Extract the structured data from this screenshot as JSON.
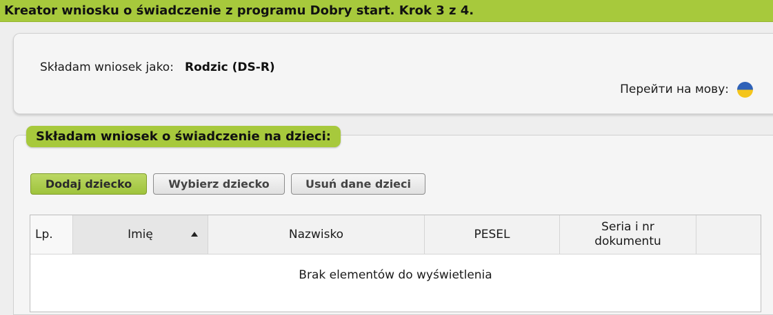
{
  "header": {
    "title": "Kreator wniosku o świadczenie z programu Dobry start. Krok 3 z 4."
  },
  "applicant": {
    "label": "Składam wniosek jako:",
    "value": "Rodzic (DS-R)"
  },
  "language_switch": {
    "label": "Перейти на мову:",
    "flag_icon": "ukraine-flag-icon"
  },
  "children_section": {
    "title": "Składam wniosek o świadczenie na dzieci:",
    "buttons": {
      "add": "Dodaj dziecko",
      "choose": "Wybierz dziecko",
      "remove": "Usuń dane dzieci"
    },
    "table": {
      "columns": [
        "Lp.",
        "Imię",
        "Nazwisko",
        "PESEL",
        "Seria i nr\ndokumentu",
        ""
      ],
      "sorted_column": "Imię",
      "sort_direction": "ascending",
      "empty_message": "Brak elementów do wyświetlenia"
    }
  },
  "colors": {
    "accent_green": "#a7c93c",
    "background": "#eeeeee",
    "panel": "#f5f5f5"
  }
}
